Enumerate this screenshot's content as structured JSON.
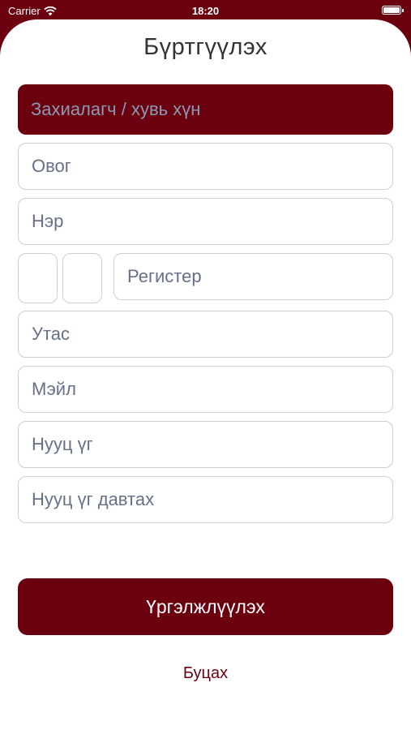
{
  "status_bar": {
    "carrier": "Carrier",
    "time": "18:20"
  },
  "title": "Бүртгүүлэх",
  "customer_type": {
    "placeholder": "Захиалагч / хувь хүн"
  },
  "fields": {
    "last_name": "Овог",
    "first_name": "Нэр",
    "register": "Регистер",
    "phone": "Утас",
    "email": "Мэйл",
    "password": "Нууц үг",
    "password_repeat": "Нууц үг давтах"
  },
  "buttons": {
    "continue": "Үргэлжлүүлэх",
    "back": "Буцах"
  },
  "colors": {
    "brand": "#6b000e",
    "placeholder": "#66708a",
    "border": "#cfcfcf"
  }
}
